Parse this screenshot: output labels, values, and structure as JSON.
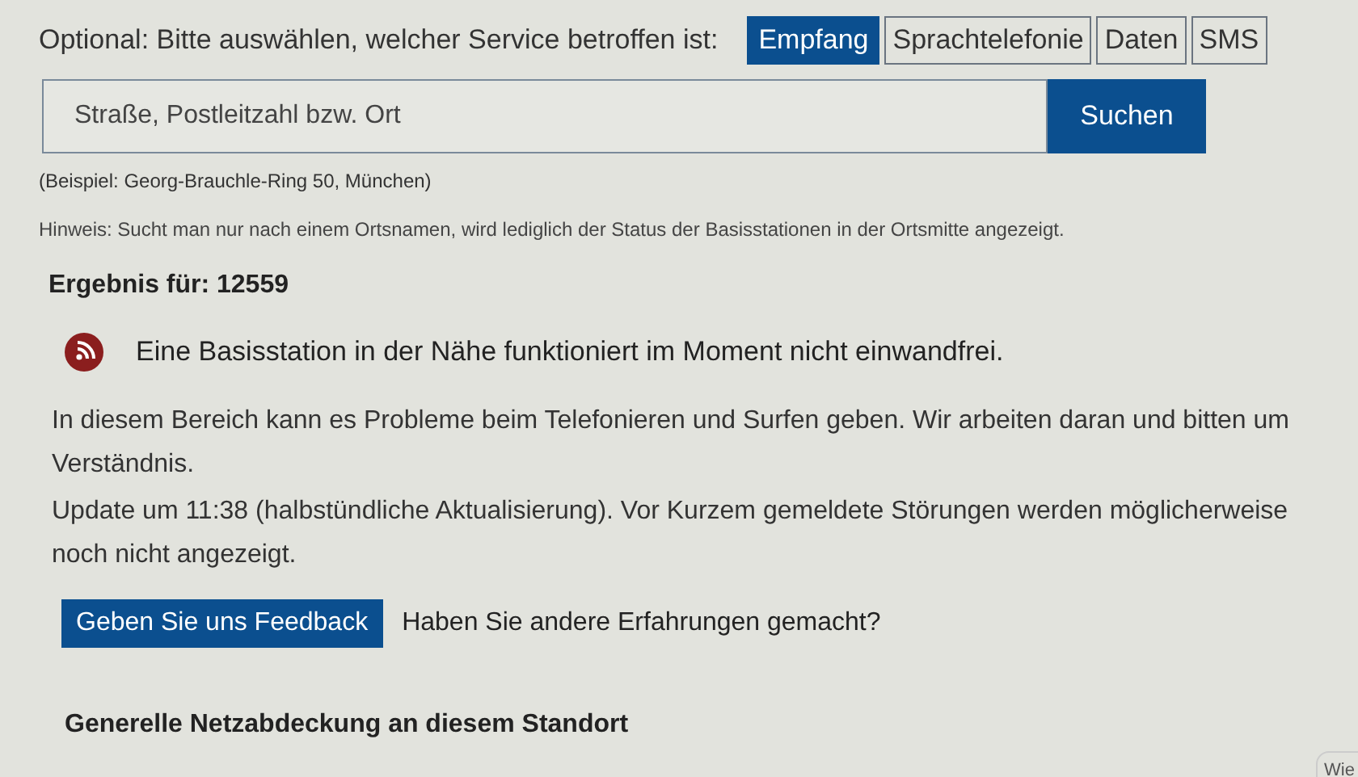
{
  "service_filter": {
    "label": "Optional: Bitte auswählen, welcher Service betroffen ist:",
    "options": [
      {
        "label": "Empfang",
        "selected": true
      },
      {
        "label": "Sprachtelefonie",
        "selected": false
      },
      {
        "label": "Daten",
        "selected": false
      },
      {
        "label": "SMS",
        "selected": false
      }
    ]
  },
  "search": {
    "placeholder": "Straße, Postleitzahl bzw. Ort",
    "button": "Suchen"
  },
  "example": "(Beispiel: Georg-Brauchle-Ring 50, München)",
  "hint": "Hinweis: Sucht man nur nach einem Ortsnamen, wird lediglich der Status der Basisstationen in der Ortsmitte angezeigt.",
  "result_heading": "Ergebnis für: 12559",
  "status": {
    "message": "Eine Basisstation in der Nähe funktioniert im Moment nicht einwandfrei.",
    "color": "#8b1e1e"
  },
  "paragraphs": [
    "In diesem Bereich kann es Probleme beim Telefonieren und Surfen geben. Wir arbeiten daran und bitten um Verständnis.",
    "Update um 11:38 (halbstündliche Aktualisierung). Vor Kurzem gemeldete Störungen werden möglicherweise noch nicht angezeigt."
  ],
  "feedback": {
    "button": "Geben Sie uns Feedback",
    "question": "Haben Sie andere Erfahrungen gemacht?"
  },
  "coverage_heading": "Generelle Netzabdeckung an diesem Standort",
  "side_button": "Wie"
}
